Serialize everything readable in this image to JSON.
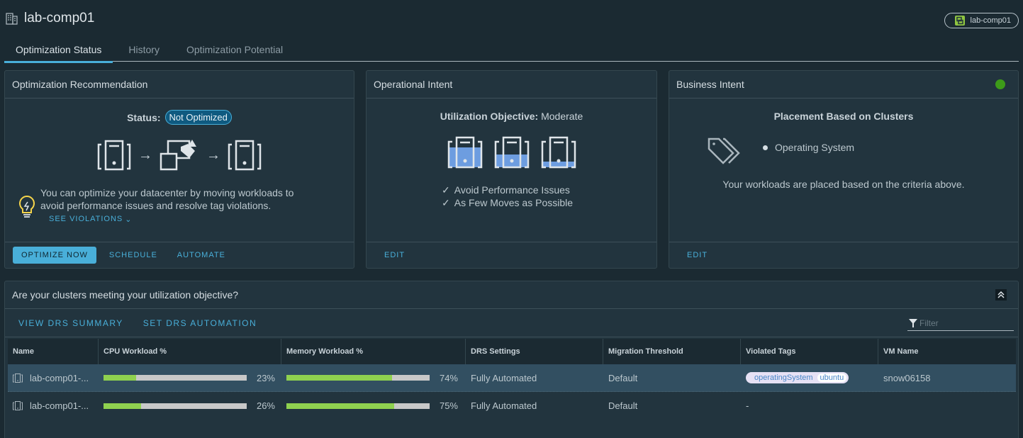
{
  "header": {
    "title": "lab-comp01",
    "object_chip": "lab-comp01"
  },
  "tabs": [
    {
      "label": "Optimization Status",
      "active": true
    },
    {
      "label": "History",
      "active": false
    },
    {
      "label": "Optimization Potential",
      "active": false
    }
  ],
  "recommendation": {
    "title": "Optimization Recommendation",
    "status_label": "Status:",
    "status_value": "Not Optimized",
    "tip_line1": "You can optimize your datacenter by moving workloads to",
    "tip_line2": "avoid performance issues and resolve tag violations.",
    "see_violations": "SEE VIOLATIONS",
    "buttons": {
      "optimize": "OPTIMIZE NOW",
      "schedule": "SCHEDULE",
      "automate": "AUTOMATE"
    }
  },
  "operational": {
    "title": "Operational Intent",
    "objective_label": "Utilization Objective:",
    "objective_value": "Moderate",
    "checks": [
      "Avoid Performance Issues",
      "As Few Moves as Possible"
    ],
    "edit": "EDIT"
  },
  "business": {
    "title": "Business Intent",
    "status_color": "#3d9b19",
    "placement_title": "Placement Based on Clusters",
    "criteria": [
      "Operating System"
    ],
    "description": "Your workloads are placed based on the criteria above.",
    "edit": "EDIT"
  },
  "clusters": {
    "title": "Are your clusters meeting your utilization objective?",
    "actions": {
      "view_drs": "VIEW DRS SUMMARY",
      "set_drs": "SET DRS AUTOMATION"
    },
    "filter_placeholder": "Filter",
    "columns": [
      "Name",
      "CPU Workload %",
      "Memory Workload %",
      "DRS Settings",
      "Migration Threshold",
      "Violated Tags",
      "VM Name"
    ],
    "rows": [
      {
        "name": "lab-comp01-...",
        "cpu": 23,
        "cpu_label": "23%",
        "mem": 74,
        "mem_label": "74%",
        "drs": "Fully Automated",
        "threshold": "Default",
        "tag_category": "operatingSystem",
        "tag_value": "ubuntu",
        "vm": "snow06158",
        "selected": true
      },
      {
        "name": "lab-comp01-...",
        "cpu": 26,
        "cpu_label": "26%",
        "mem": 75,
        "mem_label": "75%",
        "drs": "Fully Automated",
        "threshold": "Default",
        "tags_empty": "-",
        "vm": "",
        "selected": false
      }
    ]
  },
  "colors": {
    "accent": "#49afd9",
    "bar_fill": "#8fd14f",
    "bar_track": "#c8c8c8",
    "badge": "#0f5a80"
  }
}
